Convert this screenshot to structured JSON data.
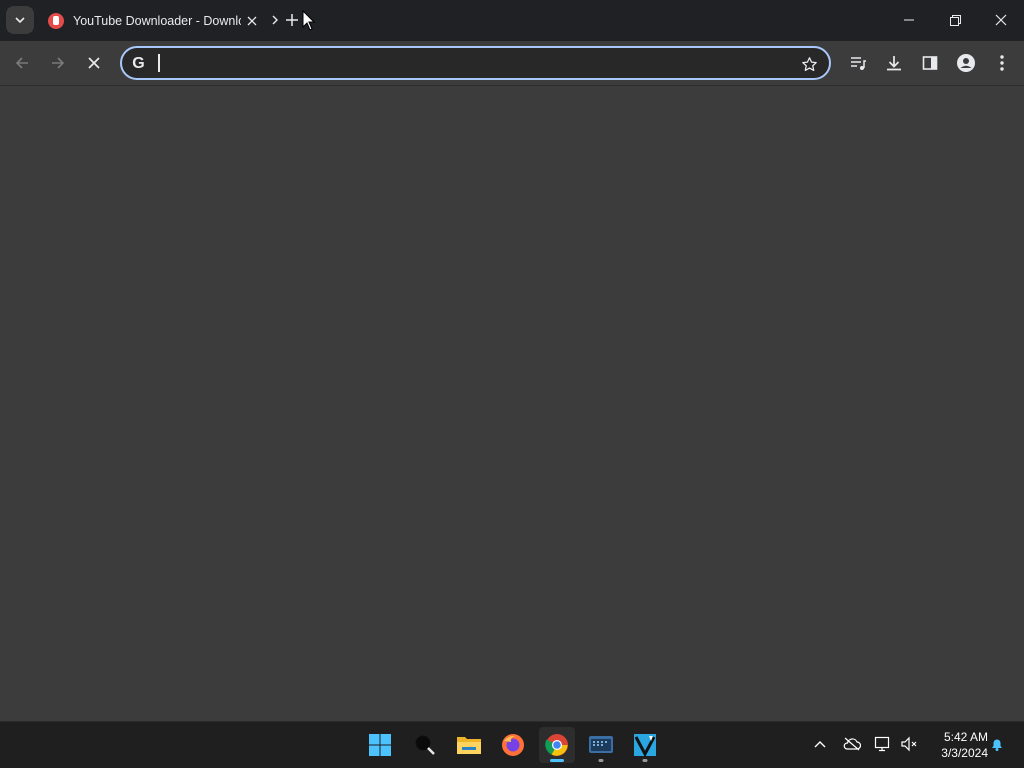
{
  "browser": {
    "tab": {
      "title": "YouTube Downloader - Downlo"
    },
    "omnibox": {
      "value": "",
      "placeholder": ""
    },
    "colors": {
      "accent": "#a8c7fa",
      "tabbar": "#202124",
      "toolbar": "#3c3c3c"
    }
  },
  "taskbar": {
    "apps": [
      "start-icon",
      "search-icon",
      "file-explorer-icon",
      "firefox-icon",
      "chrome-icon",
      "terminal-icon",
      "editor-icon"
    ],
    "clock": {
      "time": "5:42 AM",
      "date": "3/3/2024"
    }
  }
}
